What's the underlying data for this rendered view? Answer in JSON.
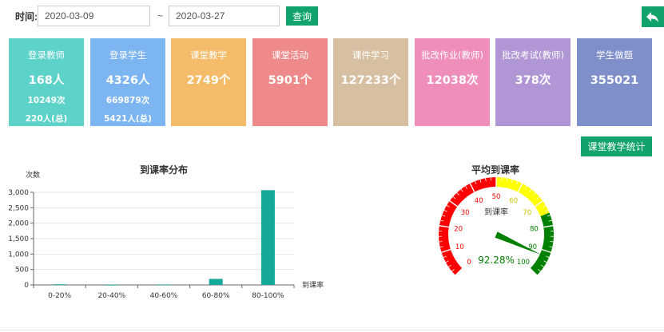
{
  "filter": {
    "time_label": "时间:",
    "start_date": "2020-03-09",
    "end_date": "2020-03-27",
    "separator": "~",
    "query_label": "查询"
  },
  "toolbar": {
    "back_icon": "undo-arrow-icon",
    "stats_button_label": "课堂教学统计"
  },
  "cards": [
    {
      "title": "登录教师",
      "value": "168人",
      "sub1": "10249次",
      "sub2": "220人(总)",
      "color": "#5dd2c9"
    },
    {
      "title": "登录学生",
      "value": "4326人",
      "sub1": "669879次",
      "sub2": "5421人(总)",
      "color": "#7cb5f2"
    },
    {
      "title": "课堂教学",
      "value": "2749个",
      "color": "#f4bc69"
    },
    {
      "title": "课堂活动",
      "value": "5901个",
      "color": "#ef8a8a"
    },
    {
      "title": "课件学习",
      "value": "127233个",
      "color": "#d7c0a2"
    },
    {
      "title": "批改作业(教师)",
      "value": "12038次",
      "color": "#f08ebb"
    },
    {
      "title": "批改考试(教师)",
      "value": "378次",
      "color": "#b196d6"
    },
    {
      "title": "学生做题",
      "value": "355021",
      "color": "#7f8fca"
    }
  ],
  "bar_chart": {
    "title": "到课率分布"
  },
  "gauge": {
    "title": "平均到课率"
  },
  "chart_data": [
    {
      "type": "bar",
      "title": "到课率分布",
      "ylabel": "次数",
      "xlabel": "到课率",
      "categories": [
        "0-20%",
        "20-40%",
        "40-60%",
        "60-80%",
        "80-100%"
      ],
      "values": [
        20,
        3,
        15,
        195,
        3070
      ],
      "ylim": [
        0,
        3000
      ],
      "yticks": [
        0,
        500,
        1000,
        1500,
        2000,
        2500,
        3000
      ],
      "ytick_labels": [
        "0",
        "500",
        "1,000",
        "1,500",
        "2,000",
        "2,500",
        "3,000"
      ],
      "bar_color": "#14a89a",
      "grid": true
    },
    {
      "type": "gauge",
      "title": "平均到课率",
      "name": "到课率",
      "value": 92.28,
      "value_label": "92.28%",
      "min": 0,
      "max": 100,
      "ticks": [
        0,
        10,
        20,
        30,
        40,
        50,
        60,
        70,
        80,
        90,
        100
      ],
      "bands": [
        {
          "to": 50,
          "color": "#ff0000"
        },
        {
          "to": 75,
          "color": "#ffff00"
        },
        {
          "to": 100,
          "color": "#008000"
        }
      ],
      "pointer_color": "#008000"
    }
  ]
}
